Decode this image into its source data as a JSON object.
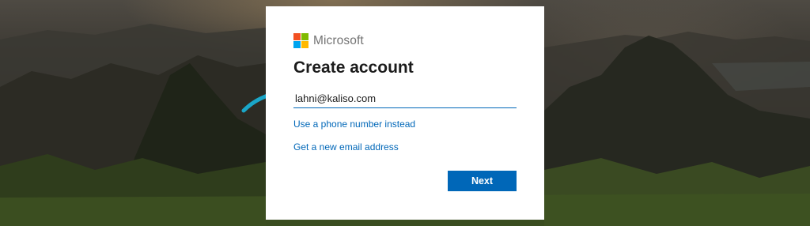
{
  "brand": {
    "name": "Microsoft",
    "logo_colors": [
      "#f25022",
      "#7fba00",
      "#00a4ef",
      "#ffb900"
    ]
  },
  "form": {
    "title": "Create account",
    "email_value": "lahni@kaliso.com",
    "phone_link": "Use a phone number instead",
    "new_email_link": "Get a new email address",
    "next_label": "Next"
  },
  "colors": {
    "accent": "#0067b8",
    "annotation_arrow": "#1aa6c8"
  },
  "annotation": {
    "icon": "arrow-icon"
  }
}
